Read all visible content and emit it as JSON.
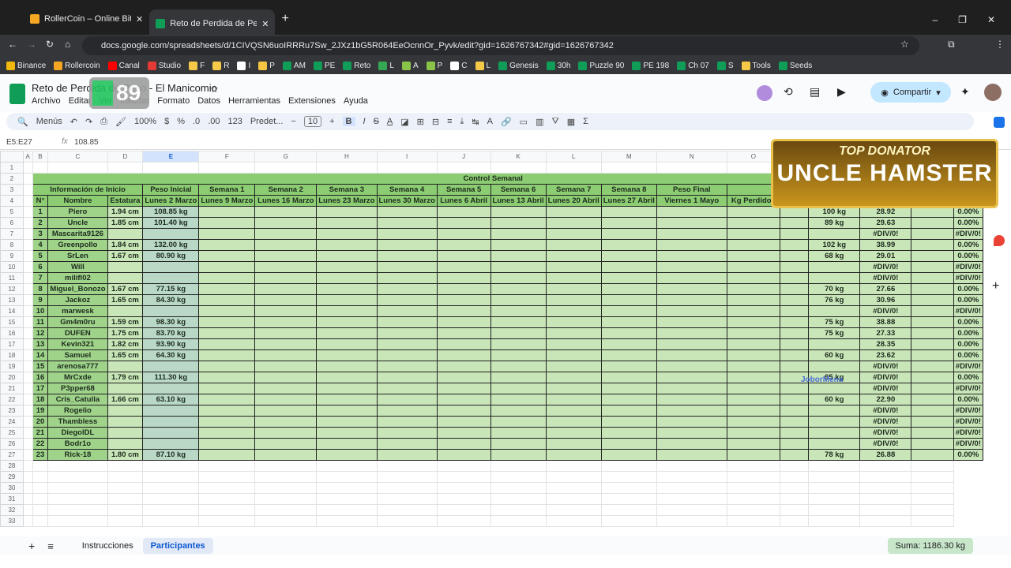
{
  "browser": {
    "tabs": [
      {
        "title": "RollerCoin – Online Bitcoin Min",
        "active": false
      },
      {
        "title": "Reto de Perdida de Peso - El M",
        "active": true
      }
    ],
    "url": "docs.google.com/spreadsheets/d/1CIVQSN6uoIRRRu7Sw_2JXz1bG5R064EeOcnnOr_Pyvk/edit?gid=1626767342#gid=1626767342",
    "bookmarks": [
      "Binance",
      "Rollercoin",
      "Canal",
      "Studio",
      "F",
      "R",
      "I",
      "P",
      "AM",
      "PE",
      "Reto",
      "L",
      "A",
      "P",
      "C",
      "L",
      "Genesis",
      "30h",
      "Puzzle 90",
      "PE 198",
      "Ch 07",
      "S",
      "Tools",
      "Seeds"
    ]
  },
  "doc": {
    "title": "Reto de Perdida de Peso - El Manicomio",
    "menus": [
      "Archivo",
      "Editar",
      "Ver",
      "Insertar",
      "Formato",
      "Datos",
      "Herramientas",
      "Extensiones",
      "Ayuda"
    ],
    "share_label": "Compartir"
  },
  "toolbar": {
    "search": "Menús",
    "zoom": "100%",
    "currency": "$",
    "percent": "%",
    "dec_less": ".0",
    "dec_more": ".00",
    "format123": "123",
    "font": "Predet...",
    "size": "10"
  },
  "formula": {
    "cell_ref": "E5:E27",
    "value": "108.85"
  },
  "overlay": {
    "badge_number": "89",
    "banner_line1": "TOP DONATOR",
    "banner_line2": "UNCLE HAMSTER",
    "floating_name": "JoborMena"
  },
  "columns": [
    "A",
    "B",
    "C",
    "D",
    "E",
    "F",
    "G",
    "H",
    "I",
    "J",
    "K",
    "L",
    "M",
    "N",
    "O",
    "P",
    "Q",
    "R",
    "S"
  ],
  "sheet": {
    "title": "Control Semanal",
    "group_header": "Información de Inicio",
    "peso_inicial": "Peso Inicial",
    "weeks": [
      "Semana 1",
      "Semana 2",
      "Semana 3",
      "Semana 4",
      "Semana 5",
      "Semana 6",
      "Semana 7",
      "Semana 8",
      "Peso Final"
    ],
    "col_headers": [
      "N°",
      "Nombre",
      "Estatura",
      "Lunes 2 Marzo",
      "Lunes 9 Marzo",
      "Lunes 16 Marzo",
      "Lunes 23 Marzo",
      "Lunes 30 Marzo",
      "Lunes 6 Abril",
      "Lunes 13 Abril",
      "Lunes 20 Abril",
      "Lunes 27 Abril",
      "Viernes 1 Mayo",
      "Kg Perdidos"
    ],
    "rows": [
      [
        "1",
        "Piero",
        "1.94 cm",
        "108.85 kg",
        "100 kg",
        "28.92",
        "0.00%"
      ],
      [
        "2",
        "Uncle",
        "1.85 cm",
        "101.40 kg",
        "89 kg",
        "29.63",
        "0.00%"
      ],
      [
        "3",
        "Mascarita9126",
        "",
        "",
        "",
        "#DIV/0!",
        "#DIV/0!"
      ],
      [
        "4",
        "Greenpollo",
        "1.84 cm",
        "132.00 kg",
        "102 kg",
        "38.99",
        "0.00%"
      ],
      [
        "5",
        "SrLen",
        "1.67 cm",
        "80.90 kg",
        "68 kg",
        "29.01",
        "0.00%"
      ],
      [
        "6",
        "Will",
        "",
        "",
        "",
        "#DIV/0!",
        "#DIV/0!"
      ],
      [
        "7",
        "milifl02",
        "",
        "",
        "",
        "#DIV/0!",
        "#DIV/0!"
      ],
      [
        "8",
        "Miguel_Bonozo",
        "1.67 cm",
        "77.15 kg",
        "70 kg",
        "27.66",
        "0.00%"
      ],
      [
        "9",
        "Jackoz",
        "1.65 cm",
        "84.30 kg",
        "76 kg",
        "30.96",
        "0.00%"
      ],
      [
        "10",
        "marwesk",
        "",
        "",
        "",
        "#DIV/0!",
        "#DIV/0!"
      ],
      [
        "11",
        "Gm4m0ru",
        "1.59 cm",
        "98.30 kg",
        "75 kg",
        "38.88",
        "0.00%"
      ],
      [
        "12",
        "DUFEN",
        "1.75 cm",
        "83.70 kg",
        "75 kg",
        "27.33",
        "0.00%"
      ],
      [
        "13",
        "Kevin321",
        "1.82 cm",
        "93.90 kg",
        "",
        "28.35",
        "0.00%"
      ],
      [
        "14",
        "Samuel",
        "1.65 cm",
        "64.30 kg",
        "60 kg",
        "23.62",
        "0.00%"
      ],
      [
        "15",
        "arenosa777",
        "",
        "",
        "",
        "#DIV/0!",
        "#DIV/0!"
      ],
      [
        "16",
        "MrCxde",
        "1.79 cm",
        "111.30 kg",
        "95 kg",
        "#DIV/0!",
        "0.00%"
      ],
      [
        "17",
        "P3pper68",
        "",
        "",
        "",
        "#DIV/0!",
        "#DIV/0!"
      ],
      [
        "18",
        "Cris_Catulla",
        "1.66 cm",
        "63.10 kg",
        "60 kg",
        "22.90",
        "0.00%"
      ],
      [
        "19",
        "Rogelio",
        "",
        "",
        "",
        "#DIV/0!",
        "#DIV/0!"
      ],
      [
        "20",
        "Thambless",
        "",
        "",
        "",
        "#DIV/0!",
        "#DIV/0!"
      ],
      [
        "21",
        "DiegolDL",
        "",
        "",
        "",
        "#DIV/0!",
        "#DIV/0!"
      ],
      [
        "22",
        "Bodr1o",
        "",
        "",
        "",
        "#DIV/0!",
        "#DIV/0!"
      ],
      [
        "23",
        "Rick-18",
        "1.80 cm",
        "87.10 kg",
        "78 kg",
        "26.88",
        "0.00%"
      ]
    ],
    "empty_row_numbers": [
      "28",
      "29",
      "30",
      "31",
      "32",
      "33"
    ]
  },
  "bottom": {
    "sheet_tabs": [
      "Instrucciones",
      "Participantes"
    ],
    "active_tab": "Participantes",
    "sum": "Suma: 1186.30 kg"
  }
}
